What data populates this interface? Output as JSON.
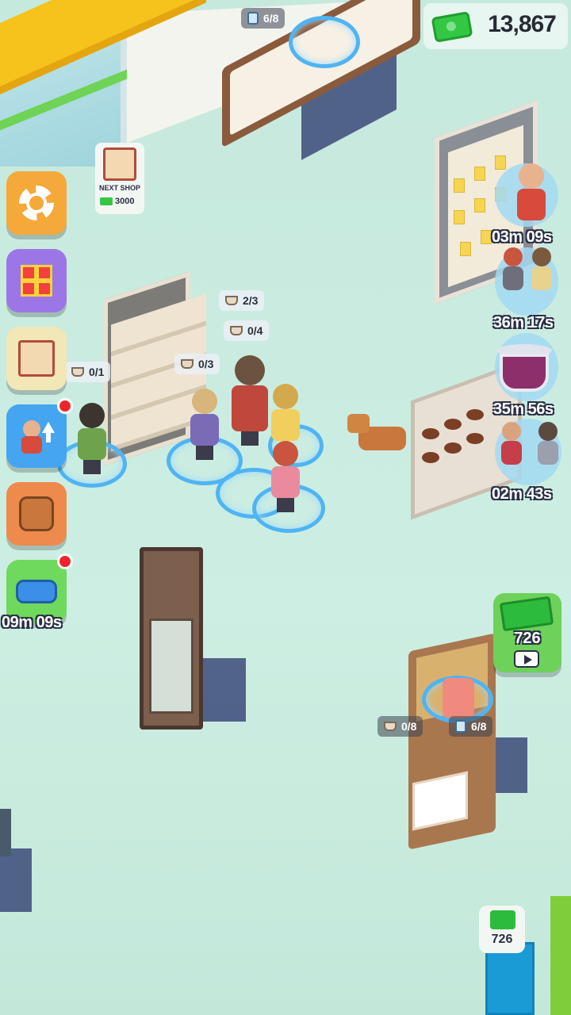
{
  "hud": {
    "money": "13,867",
    "money_icon": "cash-icon"
  },
  "side_menu": {
    "settings_icon": "gear-icon",
    "gift_icon": "gift-icon",
    "shop_icon": "shop-icon",
    "staff_icon": "staff-upgrade-icon",
    "pet_icon": "dog-icon",
    "car_icon": "car-icon",
    "car_timer": "09m 09s"
  },
  "next_shop": {
    "label": "NEXT SHOP",
    "price": "3000"
  },
  "capacities": {
    "top_counter": "6/8",
    "shelf_a": "2/3",
    "shelf_b": "0/4",
    "shelf_c": "0/3",
    "shelf_d": "0/1",
    "checkout_left": "0/8",
    "checkout_right": "6/8"
  },
  "customer_timers": {
    "t1": "03m 09s",
    "t2": "36m 17s",
    "t3": "35m 56s",
    "t4": "02m 43s"
  },
  "rewards": {
    "large_amount": "726",
    "small_amount": "726"
  },
  "colors": {
    "floor": "#c8eadf",
    "accent_green": "#34c744",
    "ring_blue": "#4fb4f2"
  }
}
